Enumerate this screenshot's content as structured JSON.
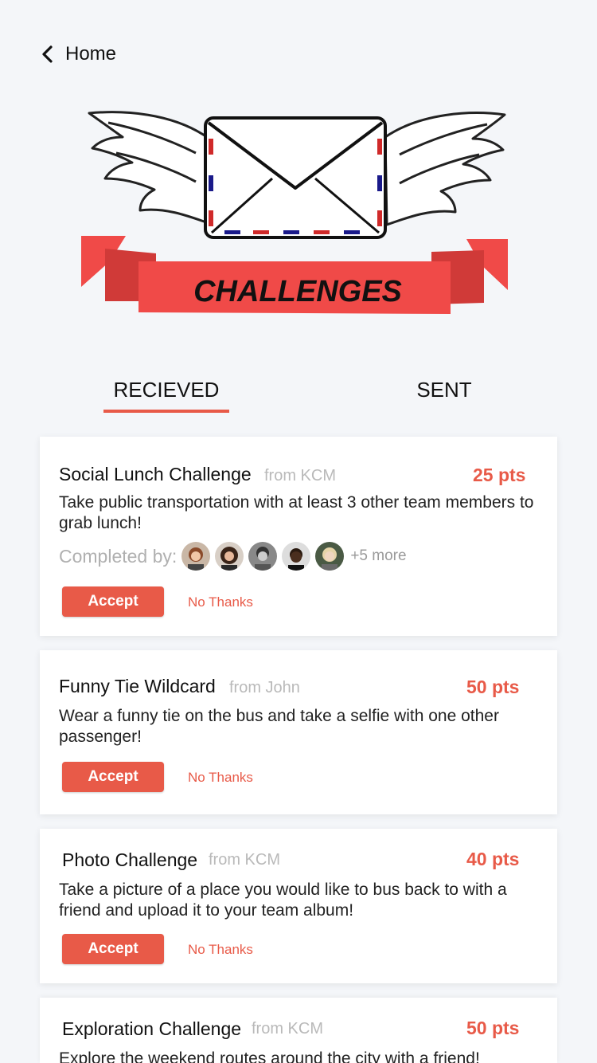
{
  "nav": {
    "back_label": "Home"
  },
  "hero": {
    "banner_text": "CHALLENGES"
  },
  "tabs": [
    {
      "label": "RECIEVED",
      "active": true
    },
    {
      "label": "SENT",
      "active": false
    }
  ],
  "colors": {
    "accent": "#e85a48",
    "ribbon": "#f04a48",
    "ribbon_dark": "#d03a38",
    "background": "#f4f6f9"
  },
  "cards": [
    {
      "title": "Social Lunch Challenge",
      "from": "from KCM",
      "points": "25 pts",
      "description": "Take public transportation with at least 3 other team members to grab lunch!",
      "completed_label": "Completed by:",
      "more": "+5 more",
      "accept_label": "Accept",
      "decline_label": "No Thanks"
    },
    {
      "title": "Funny Tie Wildcard",
      "from": "from John",
      "points": "50 pts",
      "description": "Wear a funny tie on the bus and take a selfie with one other passenger!",
      "accept_label": "Accept",
      "decline_label": "No Thanks"
    },
    {
      "title": "Photo Challenge",
      "from": "from KCM",
      "points": "40 pts",
      "description": "Take a picture of a place you would like to bus back to with a friend and upload it to your team album!",
      "accept_label": "Accept",
      "decline_label": "No Thanks"
    },
    {
      "title": "Exploration Challenge",
      "from": "from KCM",
      "points": "50 pts",
      "description": "Explore the weekend routes around the city with a friend!"
    }
  ]
}
